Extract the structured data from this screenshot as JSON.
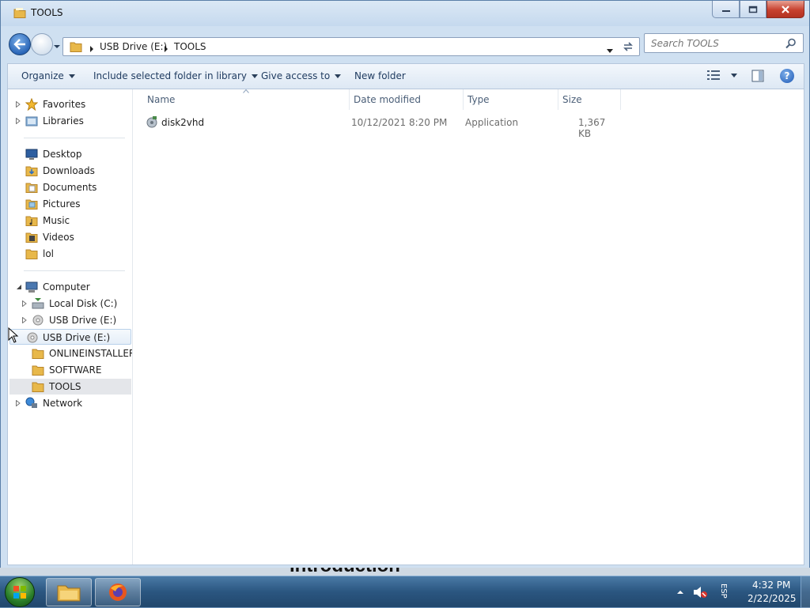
{
  "window": {
    "title": "TOOLS"
  },
  "address_bar": {
    "crumbs": [
      "USB Drive (E:)",
      "TOOLS"
    ]
  },
  "search": {
    "placeholder": "Search TOOLS"
  },
  "toolbar": {
    "organize": "Organize",
    "include_library": "Include selected folder in library",
    "give_access": "Give access to",
    "new_folder": "New folder"
  },
  "nav_pane": {
    "favorites": "Favorites",
    "libraries": "Libraries",
    "desktop": "Desktop",
    "downloads": "Downloads",
    "documents": "Documents",
    "pictures": "Pictures",
    "music": "Music",
    "videos": "Videos",
    "lol": "lol",
    "computer": "Computer",
    "local_disk": "Local Disk (C:)",
    "usb_drive_sub": "USB Drive (E:)",
    "usb_drive": "USB Drive (E:)",
    "onlineinstallers": "ONLINEINSTALLERS",
    "software": "SOFTWARE",
    "tools": "TOOLS",
    "network": "Network"
  },
  "columns": {
    "name": "Name",
    "date": "Date modified",
    "type": "Type",
    "size": "Size"
  },
  "files": [
    {
      "name": "disk2vhd",
      "date": "10/12/2021 8:20 PM",
      "type": "Application",
      "size": "1,367 KB"
    }
  ],
  "taskbar": {
    "lang": "ESP",
    "time": "4:32 PM",
    "date": "2/22/2025"
  },
  "overlay": {
    "caption": "Introduction"
  }
}
